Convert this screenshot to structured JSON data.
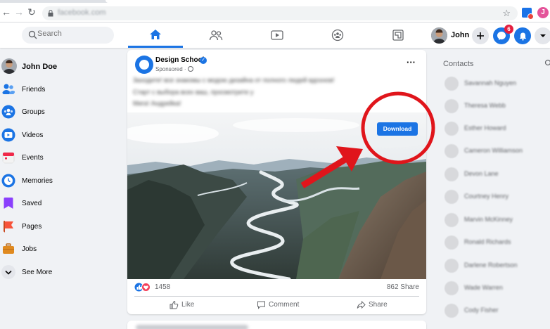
{
  "browser": {
    "url": "facebook.com",
    "profile_initial": "J"
  },
  "header": {
    "search_placeholder": "Search",
    "user_name": "John",
    "notifications_count": "6",
    "tabs": [
      {
        "icon": "home-icon",
        "active": true
      },
      {
        "icon": "friends-icon",
        "active": false
      },
      {
        "icon": "watch-icon",
        "active": false
      },
      {
        "icon": "groups-icon",
        "active": false
      },
      {
        "icon": "gaming-icon",
        "active": false
      }
    ]
  },
  "sidebar": {
    "items": [
      {
        "label": "John Doe",
        "icon": "avatar",
        "color": "#8b6f5a"
      },
      {
        "label": "Friends",
        "icon": "friends-icon",
        "color": "#1b74e4"
      },
      {
        "label": "Groups",
        "icon": "groups-icon",
        "color": "#1b74e4"
      },
      {
        "label": "Videos",
        "icon": "video-icon",
        "color": "#1b74e4"
      },
      {
        "label": "Events",
        "icon": "calendar-icon",
        "color": "#f02849"
      },
      {
        "label": "Memories",
        "icon": "clock-icon",
        "color": "#1b74e4"
      },
      {
        "label": "Saved",
        "icon": "bookmark-icon",
        "color": "#8a3ffc"
      },
      {
        "label": "Pages",
        "icon": "flag-icon",
        "color": "#f7533a"
      },
      {
        "label": "Jobs",
        "icon": "briefcase-icon",
        "color": "#e08a1f"
      },
      {
        "label": "See More",
        "icon": "chevron-down-icon",
        "color": "#e4e6eb"
      }
    ]
  },
  "post": {
    "page_name": "Design School",
    "sponsored": "Sponsored · ",
    "text_lines": [
      "Заходите! все знакомы с модою дизайна от полного людей вдохнов!",
      "Старт с выбора всех ваш, просмотрите у",
      "Мига! Андрейка!"
    ],
    "download_label": "Download",
    "reactions_count": "1458",
    "shares": "862 Share",
    "actions": [
      "Like",
      "Comment",
      "Share"
    ]
  },
  "contacts": {
    "title": "Contacts",
    "names": [
      "Savannah Nguyen",
      "Theresa Webb",
      "Esther Howard",
      "Cameron Williamson",
      "Devon Lane",
      "Courtney Henry",
      "Marvin McKinney",
      "Ronald Richards",
      "Darlene Robertson",
      "Wade Warren",
      "Cody Fisher"
    ]
  },
  "colors": {
    "brand": "#1b74e4",
    "annotation": "#e0151b"
  }
}
